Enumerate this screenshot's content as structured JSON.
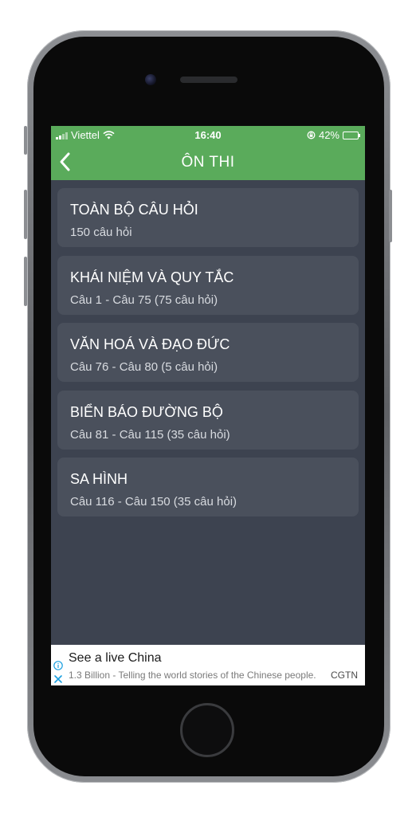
{
  "status_bar": {
    "carrier": "Viettel",
    "time": "16:40",
    "battery": "42%",
    "battery_level": 0.42
  },
  "nav": {
    "title": "ÔN THI",
    "back_icon": "chevron-left-icon"
  },
  "items": [
    {
      "title": "TOÀN BỘ CÂU HỎI",
      "subtitle": "150 câu hỏi"
    },
    {
      "title": "KHÁI NIỆM VÀ QUY TẮC",
      "subtitle": "Câu 1 - Câu 75 (75 câu hỏi)"
    },
    {
      "title": "VĂN HOÁ VÀ ĐẠO ĐỨC",
      "subtitle": "Câu 76 - Câu 80 (5 câu hỏi)"
    },
    {
      "title": "BIỂN BÁO ĐƯỜNG BỘ",
      "subtitle": "Câu 81 - Câu 115 (35 câu hỏi)"
    },
    {
      "title": "SA HÌNH",
      "subtitle": "Câu 116 - Câu 150 (35 câu hỏi)"
    }
  ],
  "ad": {
    "title": "See a live China",
    "description": "1.3 Billion - Telling the world stories of the Chinese people.",
    "brand": "CGTN"
  },
  "colors": {
    "header_green": "#5aab5b",
    "screen_bg": "#3d4350",
    "card_bg": "#4a505c",
    "ad_icon_blue": "#1a9fe0"
  }
}
